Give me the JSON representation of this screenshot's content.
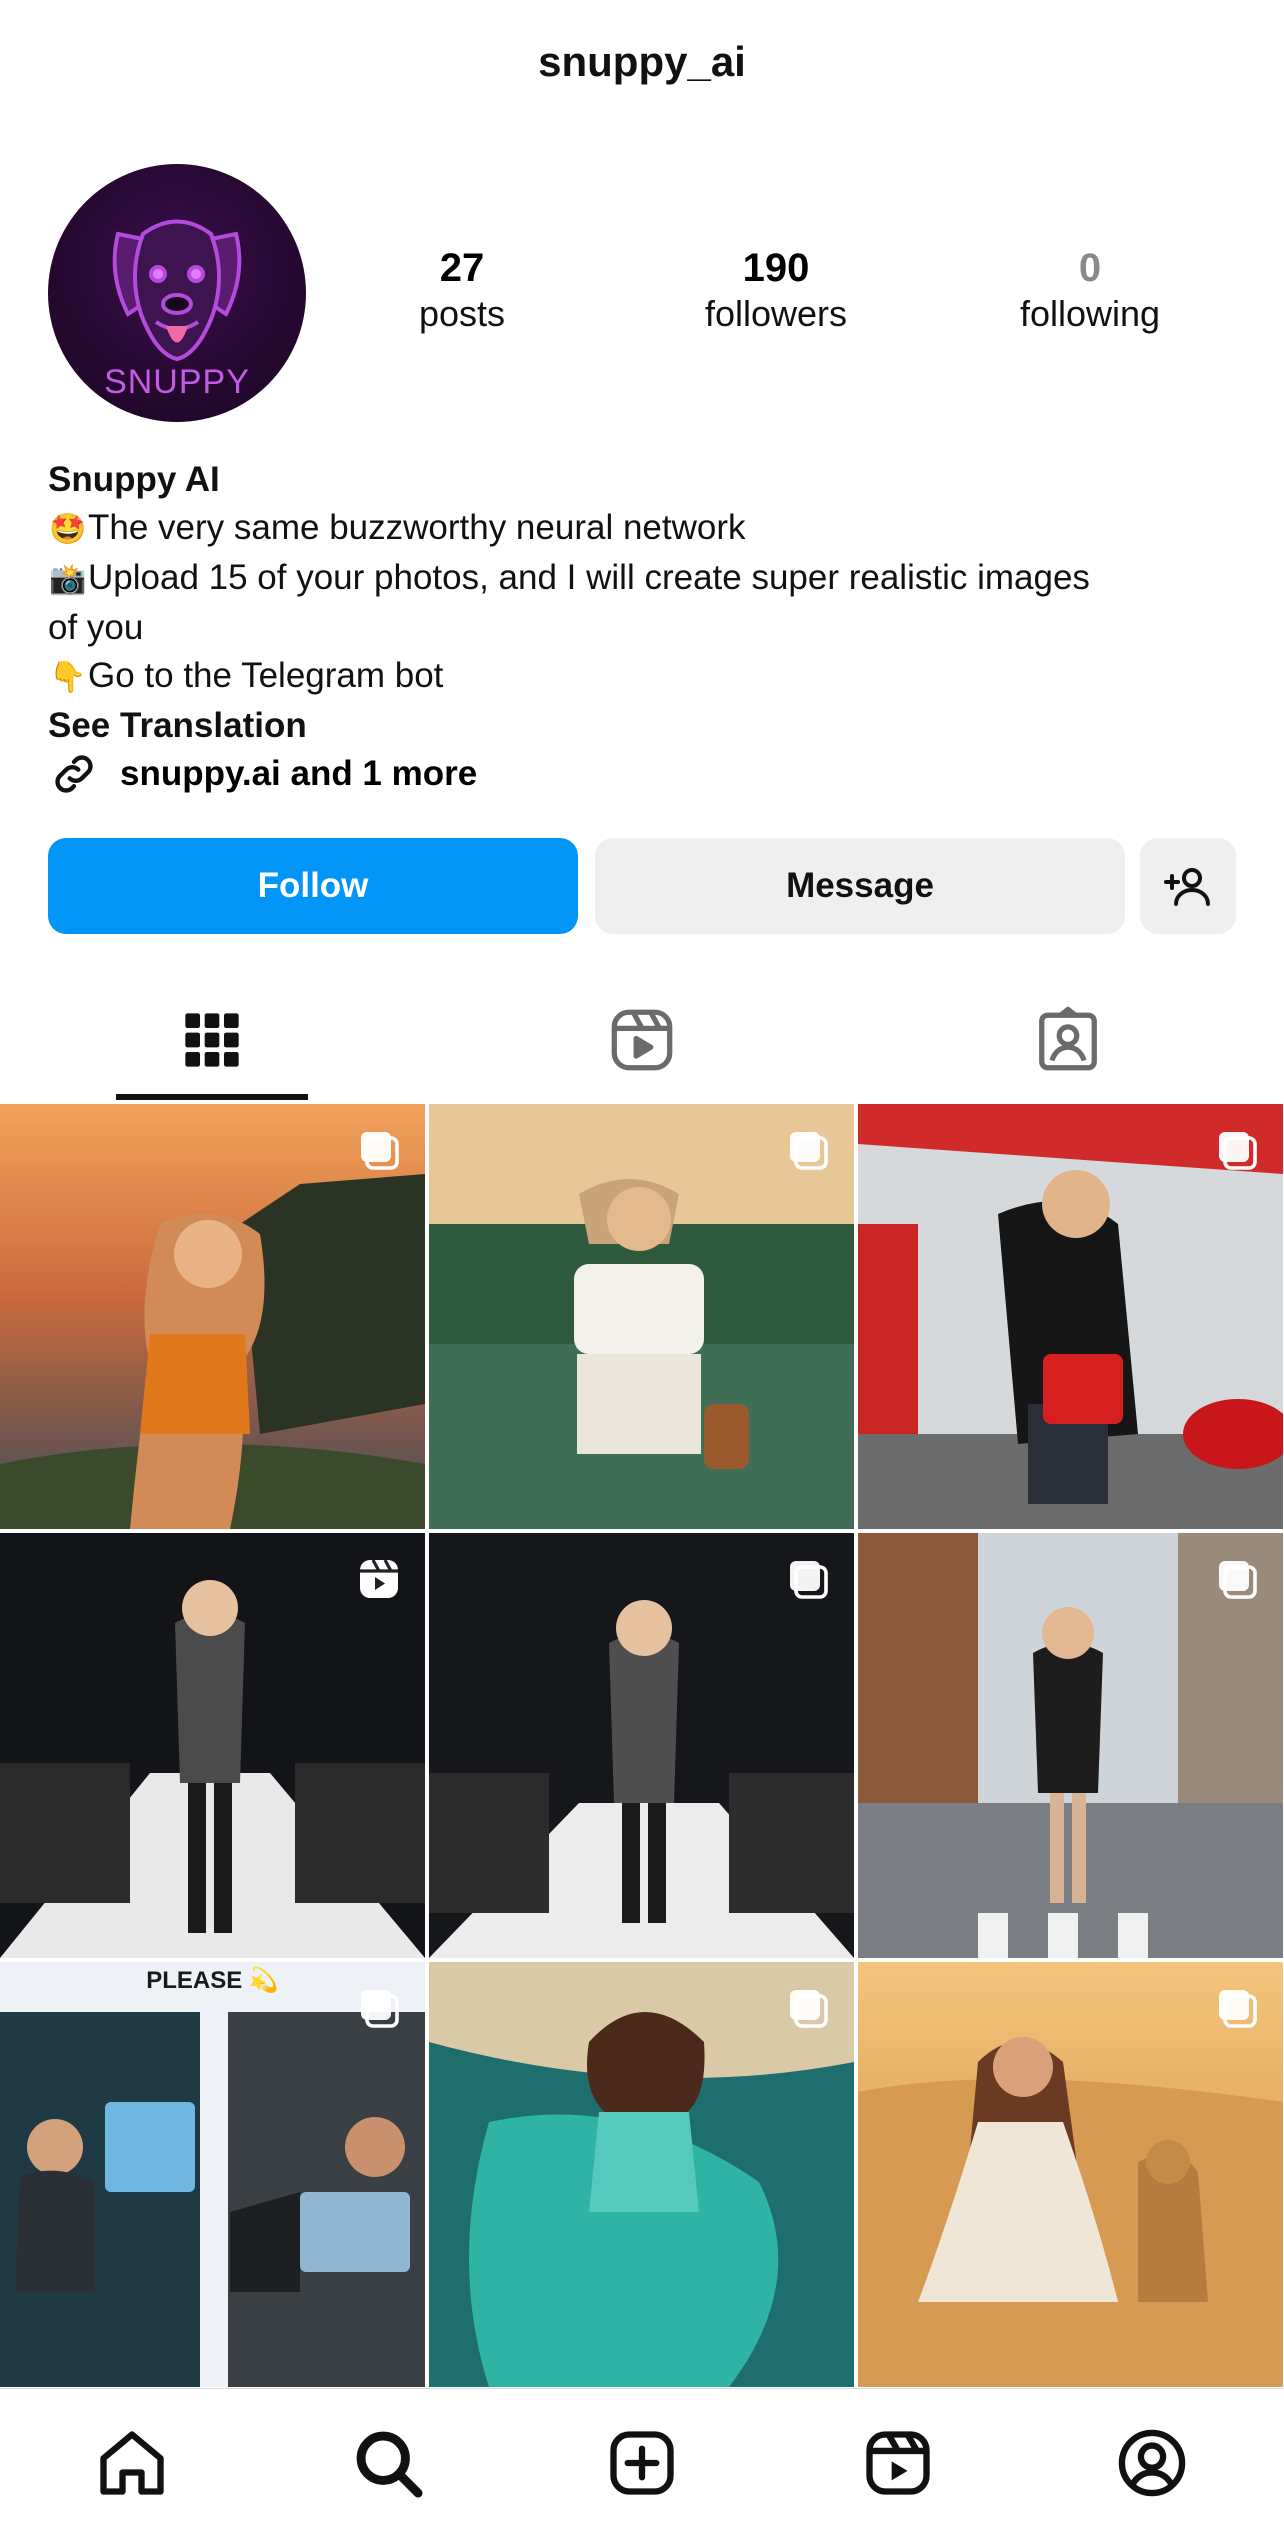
{
  "header": {
    "username": "snuppy_ai"
  },
  "profile": {
    "avatar_text": "SNUPPY",
    "stats": [
      {
        "value": "27",
        "label": "posts"
      },
      {
        "value": "190",
        "label": "followers"
      },
      {
        "value": "0",
        "label": "following"
      }
    ],
    "display_name": "Snuppy AI",
    "bio_lines": [
      {
        "emoji": "🤩",
        "text": "The very same buzzworthy neural network"
      },
      {
        "emoji": "📸",
        "text": "Upload 15 of your photos, and I will create super realistic images"
      },
      {
        "emoji": "",
        "text": "of you"
      },
      {
        "emoji": "👇",
        "text": "Go to the Telegram bot"
      }
    ],
    "see_translation": "See Translation",
    "link_text": "snuppy.ai and 1 more"
  },
  "actions": {
    "follow": "Follow",
    "message": "Message"
  },
  "tabs": [
    "grid-icon",
    "reels-icon",
    "tagged-icon"
  ],
  "grid": {
    "overlay_text": "PLEASE 💫",
    "posts": [
      {
        "badge": "carousel-icon"
      },
      {
        "badge": "carousel-icon"
      },
      {
        "badge": "carousel-icon"
      },
      {
        "badge": "reel-icon"
      },
      {
        "badge": "carousel-icon"
      },
      {
        "badge": "carousel-icon"
      },
      {
        "badge": "carousel-icon"
      },
      {
        "badge": "carousel-icon"
      },
      {
        "badge": "carousel-icon"
      }
    ]
  },
  "bottom_nav": [
    "home-icon",
    "search-icon",
    "create-icon",
    "reels-icon",
    "profile-icon"
  ],
  "colors": {
    "accent": "#0095f6",
    "button_gray": "#efefef"
  }
}
